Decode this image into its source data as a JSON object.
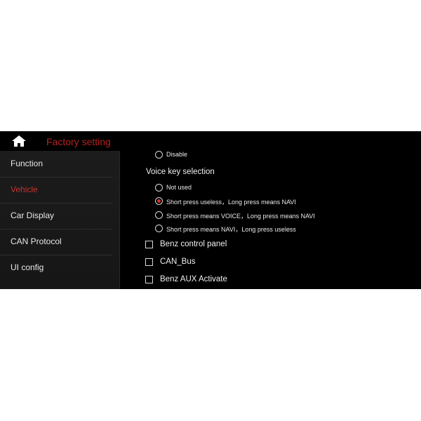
{
  "header": {
    "title": "Factory setting",
    "home_icon": "home-icon"
  },
  "sidebar": {
    "items": [
      {
        "label": "Function",
        "active": false
      },
      {
        "label": "Vehicle",
        "active": true
      },
      {
        "label": "Car Display",
        "active": false
      },
      {
        "label": "CAN Protocol",
        "active": false
      },
      {
        "label": "UI config",
        "active": false
      }
    ]
  },
  "content": {
    "top_option": {
      "label": "Disable"
    },
    "voice_key": {
      "title": "Voice key selection",
      "options": [
        {
          "label": "Not used",
          "checked": false
        },
        {
          "label": "Short press useless，Long press means NAVI",
          "checked": true
        },
        {
          "label": "Short press means VOICE，Long press means NAVI",
          "checked": false
        },
        {
          "label": "Short press means NAVI，Long press useless",
          "checked": false
        }
      ]
    },
    "checkboxes": [
      {
        "label": "Benz control panel",
        "checked": false
      },
      {
        "label": "CAN_Bus",
        "checked": false
      },
      {
        "label": "Benz AUX Activate",
        "checked": false
      }
    ]
  },
  "colors": {
    "accent": "#c8312b",
    "background": "#000000",
    "sidebar": "#1a1a1a"
  }
}
